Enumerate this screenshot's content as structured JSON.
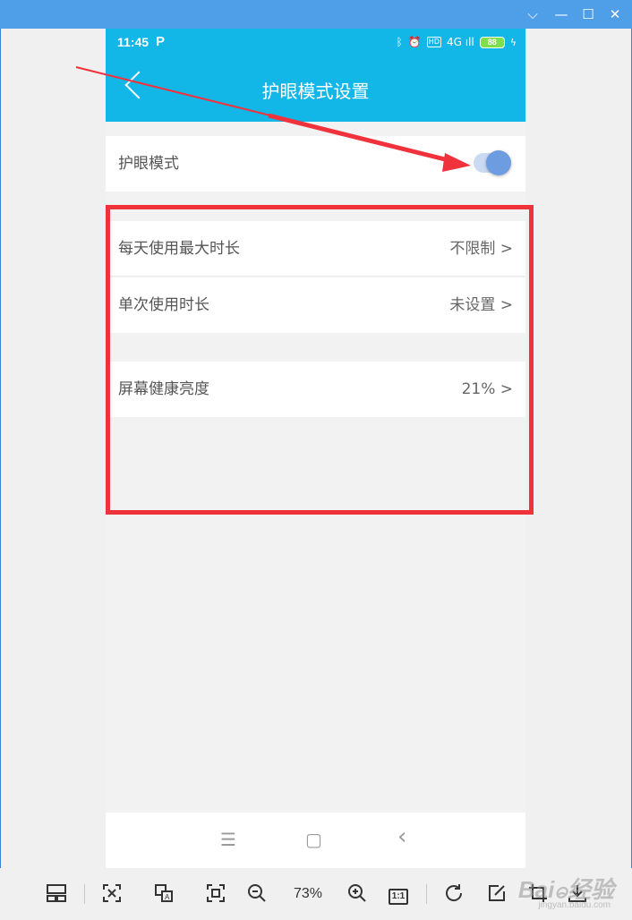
{
  "window": {
    "minimize_glyph": "⌵",
    "min_glyph": "—",
    "max_glyph": "☐",
    "close_glyph": "✕"
  },
  "phone": {
    "status": {
      "time": "11:45",
      "app_glyph": "P",
      "bt_glyph": "ᛒ",
      "alarm_glyph": "⏰",
      "hd": "HD",
      "signal": "4G ıll",
      "battery": "88",
      "charge_glyph": "ϟ"
    },
    "title": "护眼模式设置",
    "eye_mode": {
      "label": "护眼模式",
      "enabled": true
    },
    "rows": [
      {
        "label": "每天使用最大时长",
        "value": "不限制 >"
      },
      {
        "label": "单次使用时长",
        "value": "未设置 >"
      },
      {
        "label": "屏幕健康亮度",
        "value": "21% >"
      }
    ],
    "nav": {
      "menu": "☰",
      "home": "▢",
      "back": "‹"
    }
  },
  "toolbar": {
    "zoom": "73%",
    "one_to_one": "1:1",
    "icons": [
      "layout-icon",
      "fit-icon",
      "translate-icon",
      "fullscreen-icon",
      "zoom-out-icon",
      "zoom-in-icon",
      "actual-size-icon",
      "rotate-icon",
      "edit-icon",
      "crop-icon",
      "download-icon"
    ]
  },
  "watermark": {
    "main": "Baiဓ经验",
    "sub": "jingyan.baidu.com"
  },
  "colors": {
    "accent": "#12b7e8",
    "annotation": "#f0323c",
    "toggle": "#6d9ce0"
  }
}
